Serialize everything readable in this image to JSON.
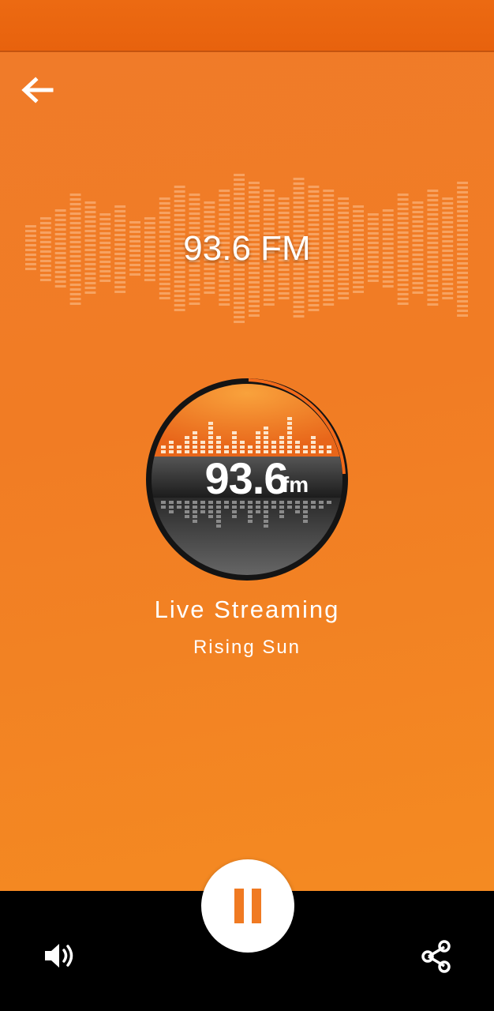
{
  "player": {
    "frequency_title": "93.6 FM",
    "logo_text": {
      "number": "93.6",
      "unit": "fm"
    },
    "stream_title": "Live Streaming",
    "stream_subtitle": "Rising Sun"
  },
  "controls": {
    "back_icon": "arrow-left-icon",
    "play_state_icon": "pause-icon",
    "volume_icon": "volume-up-icon",
    "share_icon": "share-icon"
  },
  "colors": {
    "accent": "#f17c24",
    "status_bar": "#e8620d",
    "nav_background": "#000000",
    "pause_icon": "#f07a22"
  }
}
